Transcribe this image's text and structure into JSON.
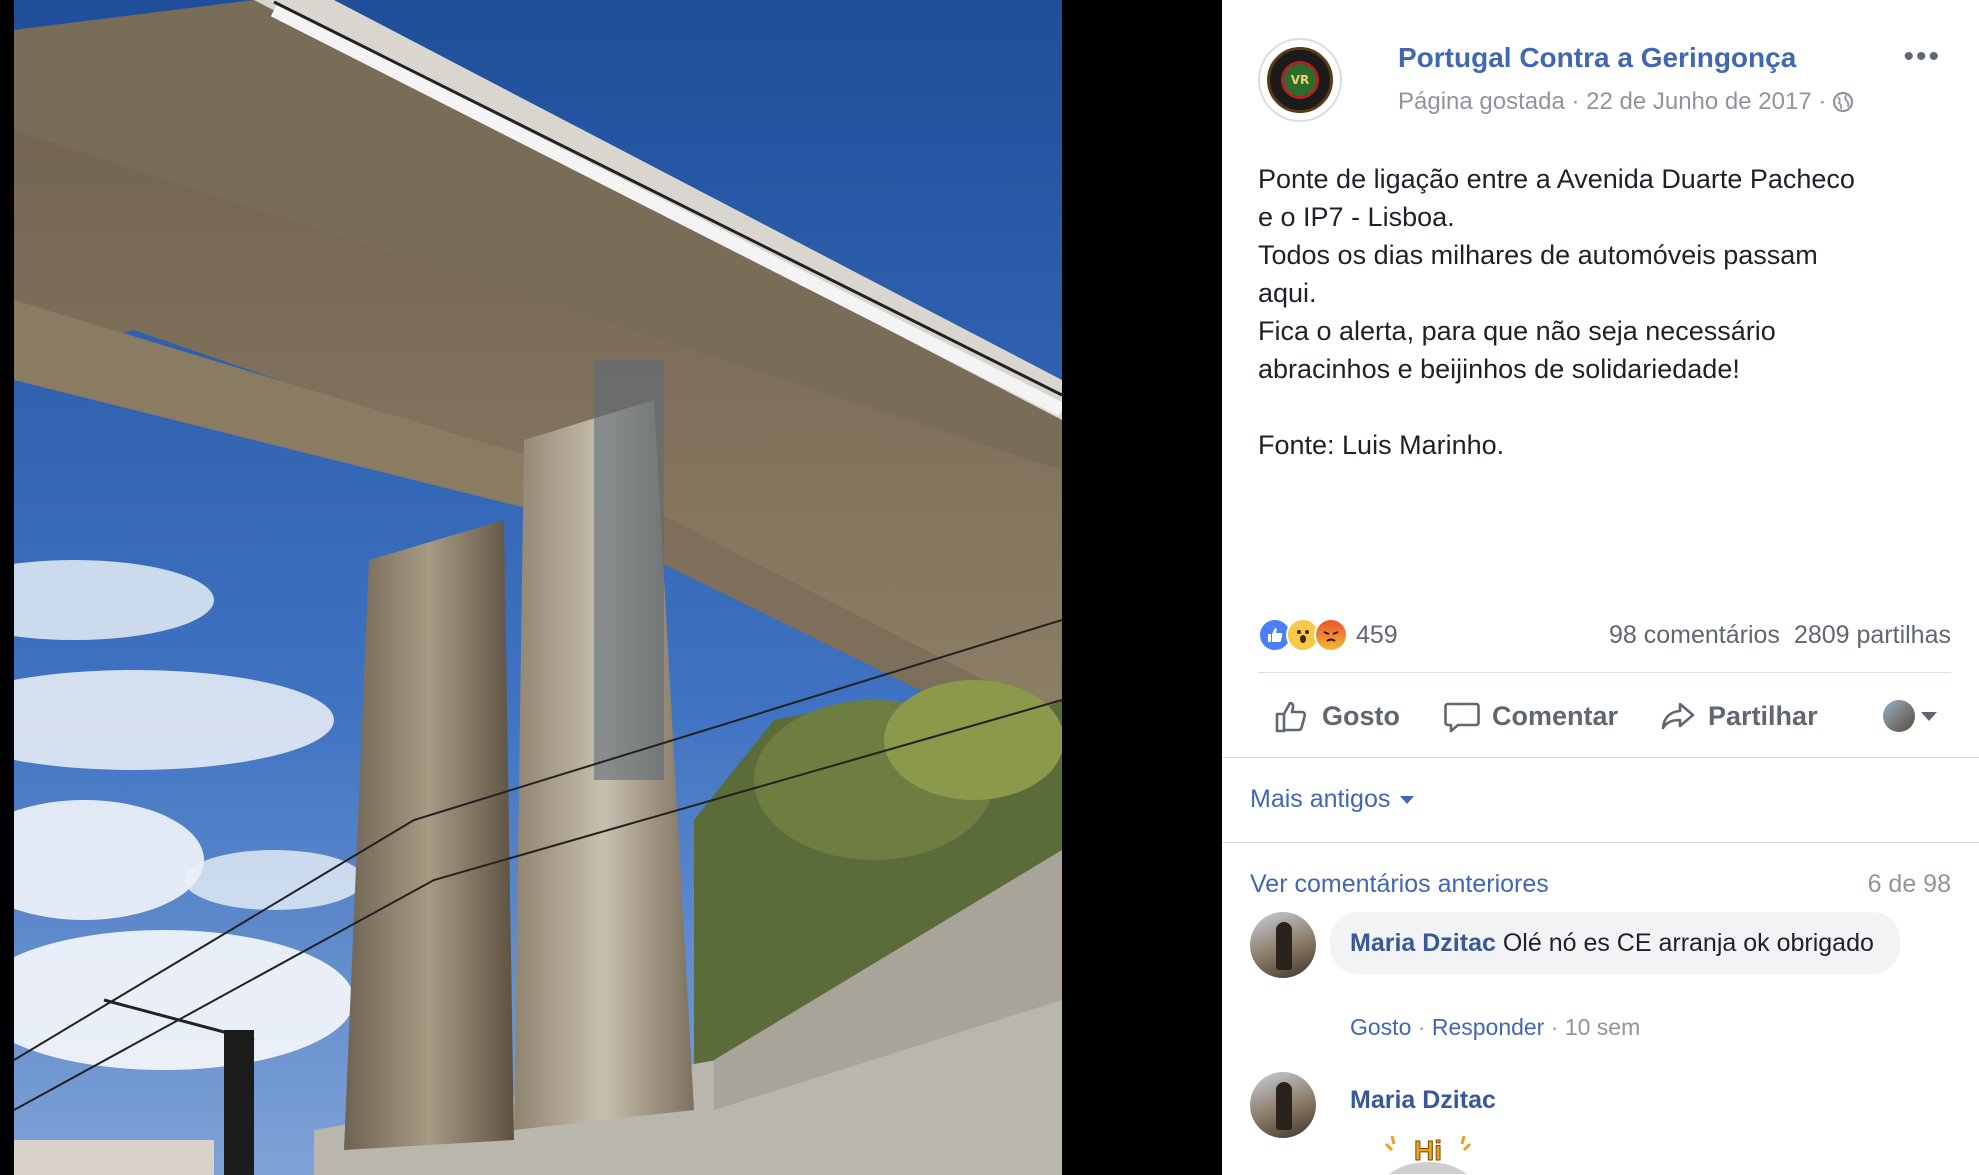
{
  "post": {
    "page_name": "Portugal Contra a Geringonça",
    "meta": "Página gostada · 22 de Junho de 2017 ·",
    "more_label": "•••",
    "avatar_text": "VR",
    "text_lines": [
      "Ponte de ligação entre a Avenida Duarte Pacheco",
      "e o IP7 - Lisboa.",
      "Todos os dias milhares de automóveis passam",
      "aqui.",
      "Fica o alerta, para que não seja necessário",
      "abracinhos e beijinhos de solidariedade!",
      "",
      "Fonte: Luis Marinho."
    ]
  },
  "stats": {
    "reaction_icons": [
      "like-icon",
      "wow-icon",
      "angry-icon"
    ],
    "reaction_count": "459",
    "comments": "98 comentários",
    "shares": "2809 partilhas"
  },
  "actions": {
    "like": "Gosto",
    "comment": "Comentar",
    "share": "Partilhar"
  },
  "comments_section": {
    "order_label": "Mais antigos",
    "view_previous": "Ver comentários anteriores",
    "count": "6 de 98",
    "items": [
      {
        "author": "Maria Dzitac",
        "text": "Olé nó es CE arranja ok obrigado",
        "like": "Gosto",
        "reply": "Responder",
        "time": "10 sem"
      },
      {
        "author": "Maria Dzitac",
        "sticker": "Hi"
      }
    ]
  },
  "colors": {
    "link": "#4267b2",
    "secondary_text": "#90949c",
    "bubble": "#f2f3f5"
  }
}
